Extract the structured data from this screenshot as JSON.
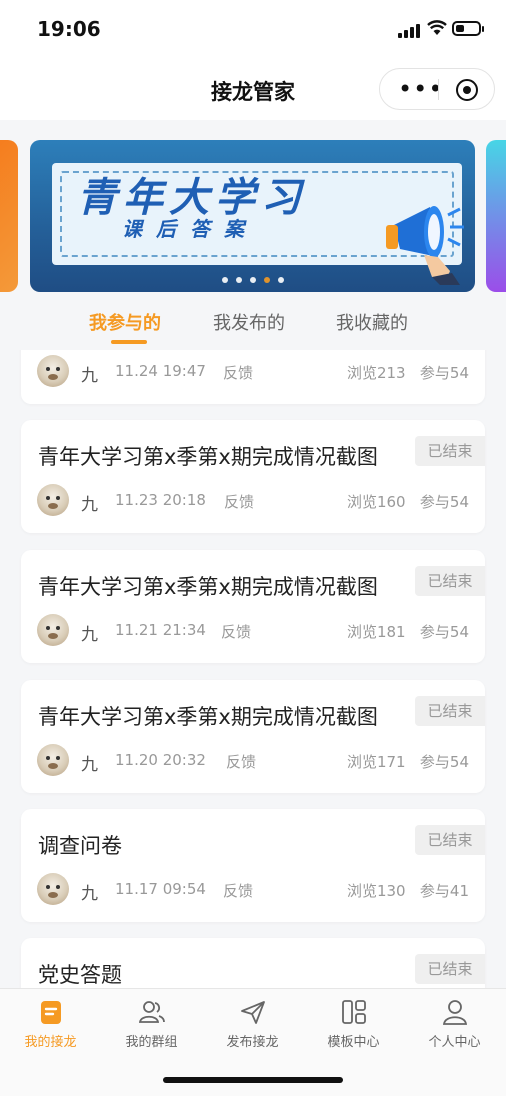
{
  "status_bar": {
    "time": "19:06"
  },
  "nav": {
    "title": "接龙管家"
  },
  "banner": {
    "title": "青年大学习",
    "subtitle": "课后答案",
    "dots_total": 5,
    "dots_active": 4
  },
  "tabs": [
    {
      "label": "我参与的",
      "active": true
    },
    {
      "label": "我发布的",
      "active": false
    },
    {
      "label": "我收藏的",
      "active": false
    }
  ],
  "cards": [
    {
      "title": "",
      "status": "",
      "author": "九",
      "time": "11.24 19:47",
      "feedback": "反馈",
      "views": "浏览213",
      "joined": "参与54"
    },
    {
      "title": "青年大学习第x季第x期完成情况截图",
      "status": "已结束",
      "author": "九",
      "time": "11.23 20:18",
      "feedback": "反馈",
      "views": "浏览160",
      "joined": "参与54"
    },
    {
      "title": "青年大学习第x季第x期完成情况截图",
      "status": "已结束",
      "author": "九",
      "time": "11.21 21:34",
      "feedback": "反馈",
      "views": "浏览181",
      "joined": "参与54"
    },
    {
      "title": "青年大学习第x季第x期完成情况截图",
      "status": "已结束",
      "author": "九",
      "time": "11.20 20:32",
      "feedback": "反馈",
      "views": "浏览171",
      "joined": "参与54"
    },
    {
      "title": "调查问卷",
      "status": "已结束",
      "author": "九",
      "time": "11.17 09:54",
      "feedback": "反馈",
      "views": "浏览130",
      "joined": "参与41"
    },
    {
      "title": "党史答题",
      "status": "已结束"
    }
  ],
  "tabbar": [
    {
      "label": "我的接龙",
      "icon": "list-icon",
      "active": true
    },
    {
      "label": "我的群组",
      "icon": "group-icon",
      "active": false
    },
    {
      "label": "发布接龙",
      "icon": "send-icon",
      "active": false
    },
    {
      "label": "模板中心",
      "icon": "template-icon",
      "active": false
    },
    {
      "label": "个人中心",
      "icon": "person-icon",
      "active": false
    }
  ],
  "colors": {
    "accent": "#f59a23",
    "banner_blue": "#1f5fb4"
  }
}
